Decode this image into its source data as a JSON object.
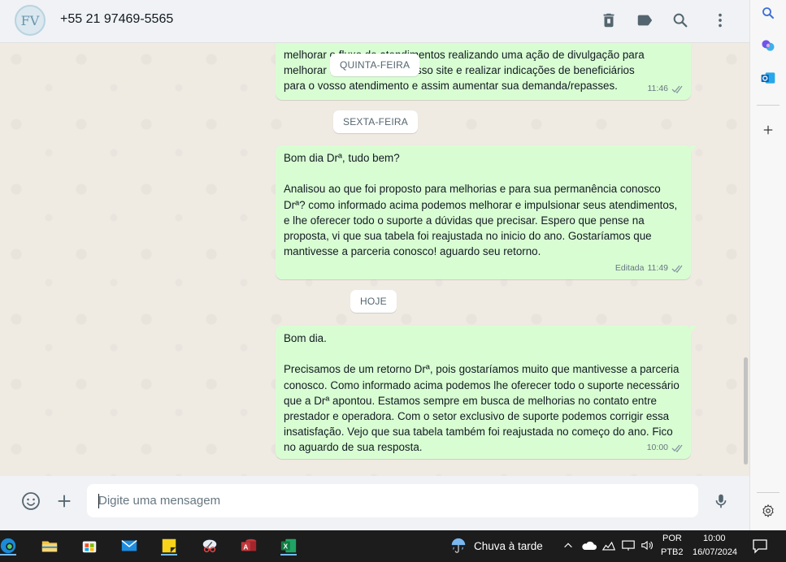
{
  "header": {
    "avatar_initials": "FV",
    "contact_name": "+55 21 97469-5565",
    "icons": [
      "trash-icon",
      "label-icon",
      "search-icon",
      "menu-icon"
    ]
  },
  "sidebar": {
    "icons": [
      "search-icon",
      "copilot-icon",
      "outlook-icon",
      "add-icon",
      "settings-icon"
    ]
  },
  "chat": {
    "partial_text": "melhorar o fluxo de atendimentos realizando uma ação de divulgação para\nmelhorar o seu perfil em nosso site e realizar indicações de beneficiários\npara o vosso atendimento e assim aumentar sua demanda/repasses.",
    "partial_time": "11:46",
    "date_quinta": "QUINTA-FEIRA",
    "date_sexta": "SEXTA-FEIRA",
    "msg1_text": "Bom dia Drª, tudo bem?\n\nAnalisou ao que foi proposto para melhorias e para sua permanência conosco Drª? como informado acima podemos melhorar e impulsionar seus atendimentos, e lhe oferecer todo o suporte a dúvidas que precisar. Espero que pense na proposta, vi que sua tabela foi reajustada no inicio do ano. Gostaríamos que mantivesse a parceria conosco! aguardo seu retorno.",
    "msg1_edited": "Editada",
    "msg1_time": "11:49",
    "date_hoje": "HOJE",
    "msg2_text": "Bom dia.\n\nPrecisamos de um retorno Drª, pois gostaríamos muito que mantivesse a parceria conosco. Como informado acima podemos lhe oferecer todo o suporte necessário que a Drª apontou. Estamos sempre em busca de melhorias no contato entre prestador e operadora. Com o setor exclusivo de suporte podemos corrigir essa insatisfação. Vejo que sua tabela também foi reajustada no começo do ano. Fico no aguardo de sua resposta.",
    "msg2_time": "10:00"
  },
  "composer": {
    "placeholder": "Digite uma mensagem",
    "icons": [
      "emoji-icon",
      "attach-plus-icon",
      "microphone-icon"
    ]
  },
  "taskbar": {
    "weather": "Chuva à tarde",
    "lang_line1": "POR",
    "lang_line2": "PTB2",
    "time": "10:00",
    "date": "16/07/2024",
    "apps": [
      "edge-icon",
      "file-explorer-icon",
      "store-icon",
      "mail-icon",
      "sticky-notes-icon",
      "snipping-tool-icon",
      "access-icon",
      "excel-icon"
    ]
  },
  "colors": {
    "outgoing_bubble": "#d9fdd3",
    "chat_background": "#efeae2",
    "header_background": "#f0f2f5",
    "tick_color": "#8696a0"
  }
}
